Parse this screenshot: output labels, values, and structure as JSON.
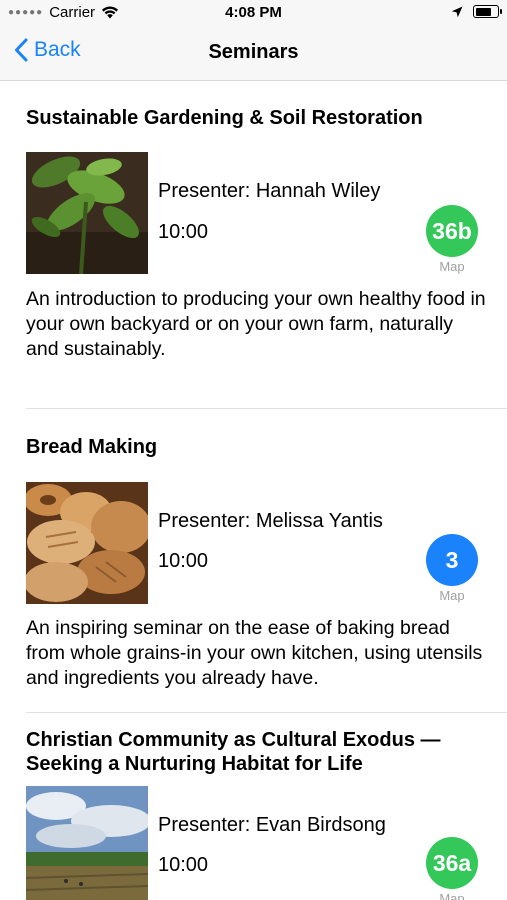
{
  "status_bar": {
    "carrier": "Carrier",
    "time": "4:08 PM",
    "battery_level": 0.85
  },
  "nav": {
    "back_label": "Back",
    "title": "Seminars"
  },
  "seminars": [
    {
      "title": "Sustainable Gardening & Soil Restoration",
      "presenter": "Presenter: Hannah Wiley",
      "time": "10:00",
      "map_code": "36b",
      "map_label": "Map",
      "map_color": "#34c759",
      "description": "An introduction to producing your own healthy food in your own backyard or on your own farm, naturally and sustainably."
    },
    {
      "title": "Bread Making",
      "presenter": "Presenter: Melissa Yantis",
      "time": "10:00",
      "map_code": "3",
      "map_label": "Map",
      "map_color": "#1a82fb",
      "description": "An inspiring seminar on the ease of baking bread from whole grains-in your own kitchen, using utensils and ingredients you already have."
    },
    {
      "title": "Christian Community as Cultural Exodus — Seeking a Nurturing Habitat for Life",
      "presenter": "Presenter: Evan Birdsong",
      "time": "10:00",
      "map_code": "36a",
      "map_label": "Map",
      "map_color": "#34c759"
    }
  ]
}
